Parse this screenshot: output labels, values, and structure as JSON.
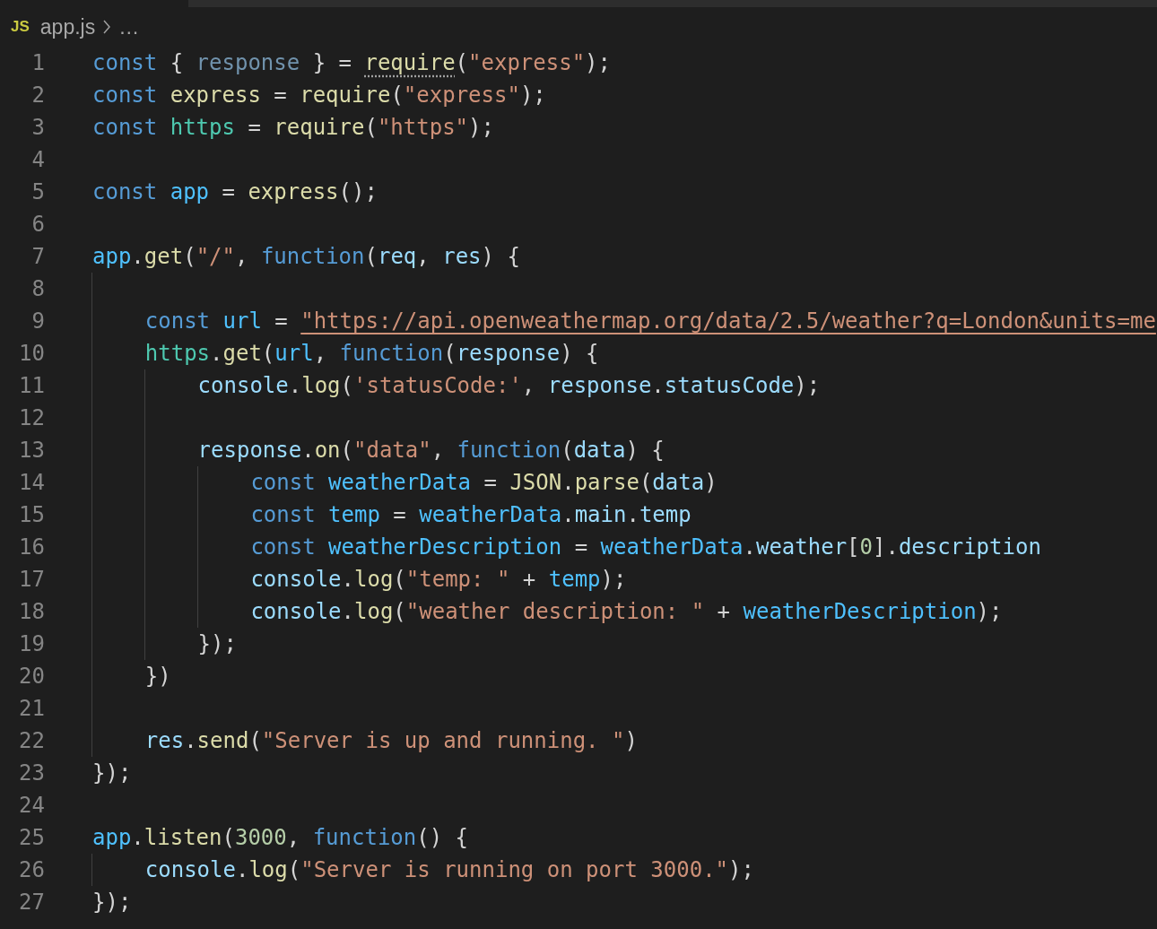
{
  "breadcrumb": {
    "file_icon_text": "JS",
    "file": "app.js",
    "more": "…"
  },
  "lines": [
    {
      "number": "1",
      "tokens": [
        {
          "kind": "kw",
          "text": "const"
        },
        {
          "kind": "punct",
          "text": " { "
        },
        {
          "kind": "unused",
          "text": "response"
        },
        {
          "kind": "punct",
          "text": " } = "
        },
        {
          "kind": "fn",
          "text": "require",
          "hint": true
        },
        {
          "kind": "punct",
          "text": "("
        },
        {
          "kind": "str",
          "text": "\"express\""
        },
        {
          "kind": "punct",
          "text": ");"
        }
      ]
    },
    {
      "number": "2",
      "tokens": [
        {
          "kind": "kw",
          "text": "const "
        },
        {
          "kind": "fn",
          "text": "express"
        },
        {
          "kind": "punct",
          "text": " = "
        },
        {
          "kind": "fn",
          "text": "require"
        },
        {
          "kind": "punct",
          "text": "("
        },
        {
          "kind": "str",
          "text": "\"express\""
        },
        {
          "kind": "punct",
          "text": ");"
        }
      ]
    },
    {
      "number": "3",
      "tokens": [
        {
          "kind": "kw",
          "text": "const "
        },
        {
          "kind": "mod",
          "text": "https"
        },
        {
          "kind": "punct",
          "text": " = "
        },
        {
          "kind": "fn",
          "text": "require"
        },
        {
          "kind": "punct",
          "text": "("
        },
        {
          "kind": "str",
          "text": "\"https\""
        },
        {
          "kind": "punct",
          "text": ");"
        }
      ]
    },
    {
      "number": "4"
    },
    {
      "number": "5",
      "tokens": [
        {
          "kind": "kw",
          "text": "const "
        },
        {
          "kind": "const",
          "text": "app"
        },
        {
          "kind": "punct",
          "text": " = "
        },
        {
          "kind": "fn",
          "text": "express"
        },
        {
          "kind": "punct",
          "text": "();"
        }
      ]
    },
    {
      "number": "6"
    },
    {
      "number": "7",
      "tokens": [
        {
          "kind": "const",
          "text": "app"
        },
        {
          "kind": "punct",
          "text": "."
        },
        {
          "kind": "fn",
          "text": "get"
        },
        {
          "kind": "punct",
          "text": "("
        },
        {
          "kind": "str",
          "text": "\"/\""
        },
        {
          "kind": "punct",
          "text": ", "
        },
        {
          "kind": "kw",
          "text": "function"
        },
        {
          "kind": "punct",
          "text": "("
        },
        {
          "kind": "var",
          "text": "req"
        },
        {
          "kind": "punct",
          "text": ", "
        },
        {
          "kind": "var",
          "text": "res"
        },
        {
          "kind": "punct",
          "text": ") {"
        }
      ]
    },
    {
      "number": "8"
    },
    {
      "number": "9",
      "tokens": [
        {
          "kind": "kw",
          "text": "    const "
        },
        {
          "kind": "const",
          "text": "url"
        },
        {
          "kind": "punct",
          "text": " = "
        },
        {
          "kind": "link",
          "text": "\"https://api.openweathermap.org/data/2.5/weather?q=London&units=me"
        }
      ]
    },
    {
      "number": "10",
      "tokens": [
        {
          "kind": "mod",
          "text": "    https"
        },
        {
          "kind": "punct",
          "text": "."
        },
        {
          "kind": "fn",
          "text": "get"
        },
        {
          "kind": "punct",
          "text": "("
        },
        {
          "kind": "const",
          "text": "url"
        },
        {
          "kind": "punct",
          "text": ", "
        },
        {
          "kind": "kw",
          "text": "function"
        },
        {
          "kind": "punct",
          "text": "("
        },
        {
          "kind": "var",
          "text": "response"
        },
        {
          "kind": "punct",
          "text": ") {"
        }
      ]
    },
    {
      "number": "11",
      "tokens": [
        {
          "kind": "var",
          "text": "        console"
        },
        {
          "kind": "punct",
          "text": "."
        },
        {
          "kind": "fn",
          "text": "log"
        },
        {
          "kind": "punct",
          "text": "("
        },
        {
          "kind": "str",
          "text": "'statusCode:'"
        },
        {
          "kind": "punct",
          "text": ", "
        },
        {
          "kind": "var",
          "text": "response"
        },
        {
          "kind": "punct",
          "text": "."
        },
        {
          "kind": "var",
          "text": "statusCode"
        },
        {
          "kind": "punct",
          "text": ");"
        }
      ]
    },
    {
      "number": "12"
    },
    {
      "number": "13",
      "tokens": [
        {
          "kind": "var",
          "text": "        response"
        },
        {
          "kind": "punct",
          "text": "."
        },
        {
          "kind": "fn",
          "text": "on"
        },
        {
          "kind": "punct",
          "text": "("
        },
        {
          "kind": "str",
          "text": "\"data\""
        },
        {
          "kind": "punct",
          "text": ", "
        },
        {
          "kind": "kw",
          "text": "function"
        },
        {
          "kind": "punct",
          "text": "("
        },
        {
          "kind": "var",
          "text": "data"
        },
        {
          "kind": "punct",
          "text": ") {"
        }
      ]
    },
    {
      "number": "14",
      "tokens": [
        {
          "kind": "kw",
          "text": "            const "
        },
        {
          "kind": "const",
          "text": "weatherData"
        },
        {
          "kind": "punct",
          "text": " = "
        },
        {
          "kind": "fn",
          "text": "JSON"
        },
        {
          "kind": "punct",
          "text": "."
        },
        {
          "kind": "fn",
          "text": "parse"
        },
        {
          "kind": "punct",
          "text": "("
        },
        {
          "kind": "var",
          "text": "data"
        },
        {
          "kind": "punct",
          "text": ")"
        }
      ]
    },
    {
      "number": "15",
      "tokens": [
        {
          "kind": "kw",
          "text": "            const "
        },
        {
          "kind": "const",
          "text": "temp"
        },
        {
          "kind": "punct",
          "text": " = "
        },
        {
          "kind": "const",
          "text": "weatherData"
        },
        {
          "kind": "punct",
          "text": "."
        },
        {
          "kind": "var",
          "text": "main"
        },
        {
          "kind": "punct",
          "text": "."
        },
        {
          "kind": "var",
          "text": "temp"
        }
      ]
    },
    {
      "number": "16",
      "tokens": [
        {
          "kind": "kw",
          "text": "            const "
        },
        {
          "kind": "const",
          "text": "weatherDescription"
        },
        {
          "kind": "punct",
          "text": " = "
        },
        {
          "kind": "const",
          "text": "weatherData"
        },
        {
          "kind": "punct",
          "text": "."
        },
        {
          "kind": "var",
          "text": "weather"
        },
        {
          "kind": "punct",
          "text": "["
        },
        {
          "kind": "num",
          "text": "0"
        },
        {
          "kind": "punct",
          "text": "]."
        },
        {
          "kind": "var",
          "text": "description"
        }
      ]
    },
    {
      "number": "17",
      "tokens": [
        {
          "kind": "var",
          "text": "            console"
        },
        {
          "kind": "punct",
          "text": "."
        },
        {
          "kind": "fn",
          "text": "log"
        },
        {
          "kind": "punct",
          "text": "("
        },
        {
          "kind": "str",
          "text": "\"temp: \""
        },
        {
          "kind": "punct",
          "text": " + "
        },
        {
          "kind": "const",
          "text": "temp"
        },
        {
          "kind": "punct",
          "text": ");"
        }
      ]
    },
    {
      "number": "18",
      "tokens": [
        {
          "kind": "var",
          "text": "            console"
        },
        {
          "kind": "punct",
          "text": "."
        },
        {
          "kind": "fn",
          "text": "log"
        },
        {
          "kind": "punct",
          "text": "("
        },
        {
          "kind": "str",
          "text": "\"weather description: \""
        },
        {
          "kind": "punct",
          "text": " + "
        },
        {
          "kind": "const",
          "text": "weatherDescription"
        },
        {
          "kind": "punct",
          "text": ");"
        }
      ]
    },
    {
      "number": "19",
      "tokens": [
        {
          "kind": "punct",
          "text": "        });"
        }
      ]
    },
    {
      "number": "20",
      "tokens": [
        {
          "kind": "punct",
          "text": "    })"
        }
      ]
    },
    {
      "number": "21"
    },
    {
      "number": "22",
      "tokens": [
        {
          "kind": "var",
          "text": "    res"
        },
        {
          "kind": "punct",
          "text": "."
        },
        {
          "kind": "fn",
          "text": "send"
        },
        {
          "kind": "punct",
          "text": "("
        },
        {
          "kind": "str",
          "text": "\"Server is up and running. \""
        },
        {
          "kind": "punct",
          "text": ")"
        }
      ]
    },
    {
      "number": "23",
      "tokens": [
        {
          "kind": "punct",
          "text": "});"
        }
      ]
    },
    {
      "number": "24"
    },
    {
      "number": "25",
      "tokens": [
        {
          "kind": "const",
          "text": "app"
        },
        {
          "kind": "punct",
          "text": "."
        },
        {
          "kind": "fn",
          "text": "listen"
        },
        {
          "kind": "punct",
          "text": "("
        },
        {
          "kind": "num",
          "text": "3000"
        },
        {
          "kind": "punct",
          "text": ", "
        },
        {
          "kind": "kw",
          "text": "function"
        },
        {
          "kind": "punct",
          "text": "() {"
        }
      ]
    },
    {
      "number": "26",
      "tokens": [
        {
          "kind": "var",
          "text": "    console"
        },
        {
          "kind": "punct",
          "text": "."
        },
        {
          "kind": "fn",
          "text": "log"
        },
        {
          "kind": "punct",
          "text": "("
        },
        {
          "kind": "str",
          "text": "\"Server is running on port 3000.\""
        },
        {
          "kind": "punct",
          "text": ");"
        }
      ]
    },
    {
      "number": "27",
      "tokens": [
        {
          "kind": "punct",
          "text": "});"
        }
      ]
    }
  ]
}
